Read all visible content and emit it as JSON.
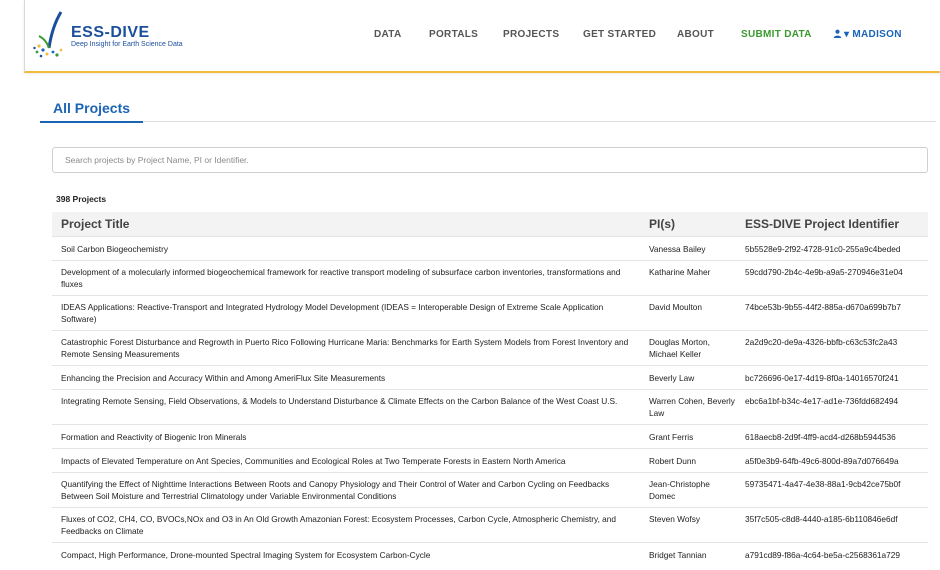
{
  "header": {
    "logo_name": "ESS-DIVE",
    "logo_tagline": "Deep Insight for Earth Science Data",
    "nav": [
      {
        "label": "DATA",
        "kind": "normal"
      },
      {
        "label": "PORTALS",
        "kind": "normal"
      },
      {
        "label": "PROJECTS",
        "kind": "normal"
      },
      {
        "label": "GET STARTED",
        "kind": "normal"
      },
      {
        "label": "ABOUT",
        "kind": "normal"
      },
      {
        "label": "SUBMIT DATA",
        "kind": "submit"
      },
      {
        "label": "▾ MADISON",
        "kind": "user"
      }
    ],
    "colors": {
      "brand": "#1b4f9c",
      "accent": "#1b64b8",
      "submit": "#3a9a2f",
      "border": "#f2bb3a"
    }
  },
  "page": {
    "tab_label": "All Projects",
    "search_placeholder": "Search projects by Project Name, PI or Identifier.",
    "count_label": "398 Projects"
  },
  "table": {
    "columns": [
      "Project Title",
      "PI(s)",
      "ESS-DIVE Project Identifier"
    ],
    "rows": [
      {
        "title": "Soil Carbon Biogeochemistry",
        "pi": "Vanessa Bailey",
        "id": "5b5528e9-2f92-4728-91c0-255a9c4beded"
      },
      {
        "title": "Development of a molecularly informed biogeochemical framework for reactive transport modeling of subsurface carbon inventories, transformations and fluxes",
        "pi": "Katharine Maher",
        "id": "59cdd790-2b4c-4e9b-a9a5-270946e31e04"
      },
      {
        "title": "IDEAS Applications: Reactive-Transport and Integrated Hydrology Model Development (IDEAS = Interoperable Design of Extreme Scale Application Software)",
        "pi": "David Moulton",
        "id": "74bce53b-9b55-44f2-885a-d670a699b7b7"
      },
      {
        "title": "Catastrophic Forest Disturbance and Regrowth in Puerto Rico Following Hurricane Maria: Benchmarks for Earth System Models from Forest Inventory and Remote Sensing Measurements",
        "pi": "Douglas Morton, Michael Keller",
        "id": "2a2d9c20-de9a-4326-bbfb-c63c53fc2a43"
      },
      {
        "title": "Enhancing the Precision and Accuracy Within and Among AmeriFlux Site Measurements",
        "pi": "Beverly Law",
        "id": "bc726696-0e17-4d19-8f0a-14016570f241"
      },
      {
        "title": "Integrating Remote Sensing, Field Observations, & Models to Understand Disturbance & Climate Effects on the Carbon Balance of the West Coast U.S.",
        "pi": "Warren Cohen, Beverly Law",
        "id": "ebc6a1bf-b34c-4e17-ad1e-736fdd682494"
      },
      {
        "title": "Formation and Reactivity of Biogenic Iron Minerals",
        "pi": "Grant Ferris",
        "id": "618aecb8-2d9f-4ff9-acd4-d268b5944536"
      },
      {
        "title": "Impacts of Elevated Temperature on Ant Species, Communities and Ecological Roles at Two Temperate Forests in Eastern North America",
        "pi": "Robert Dunn",
        "id": "a5f0e3b9-64fb-49c6-800d-89a7d076649a"
      },
      {
        "title": "Quantifying the Effect of Nighttime Interactions Between Roots and Canopy Physiology and Their Control of Water and Carbon Cycling on Feedbacks Between Soil Moisture and Terrestrial Climatology under Variable Environmental Conditions",
        "pi": "Jean-Christophe Domec",
        "id": "59735471-4a47-4e38-88a1-9cb42ce75b0f"
      },
      {
        "title": "Fluxes of CO2, CH4, CO, BVOCs,NOx and O3 in An Old Growth Amazonian Forest: Ecosystem Processes, Carbon Cycle, Atmospheric Chemistry, and Feedbacks on Climate",
        "pi": "Steven Wofsy",
        "id": "35f7c505-c8d8-4440-a185-6b110846e6df"
      },
      {
        "title": "Compact, High Performance, Drone-mounted Spectral Imaging System for Ecosystem Carbon-Cycle",
        "pi": "Bridget Tannian",
        "id": "a791cd89-f86a-4c64-be5a-c2568361a729"
      }
    ]
  }
}
